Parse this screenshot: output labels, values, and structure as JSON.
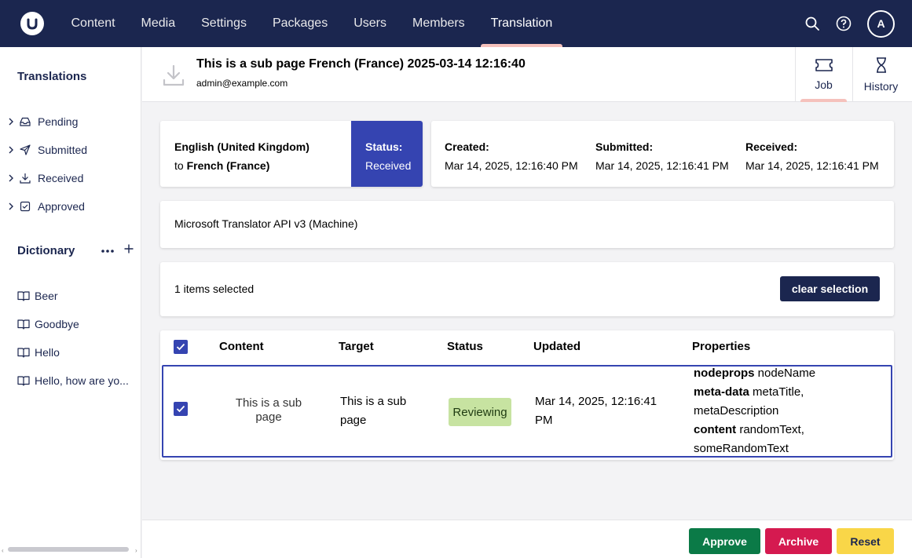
{
  "topbar": {
    "nav": [
      "Content",
      "Media",
      "Settings",
      "Packages",
      "Users",
      "Members",
      "Translation"
    ],
    "active": "Translation",
    "avatar_initial": "A",
    "colors": {
      "bar": "#1b264f",
      "active_underline": "#f5c1bc"
    }
  },
  "sidebar": {
    "translations_heading": "Translations",
    "items": [
      {
        "label": "Pending",
        "icon": "inbox-icon"
      },
      {
        "label": "Submitted",
        "icon": "send-icon"
      },
      {
        "label": "Received",
        "icon": "download-icon"
      },
      {
        "label": "Approved",
        "icon": "check-square-icon"
      }
    ],
    "dictionary_heading": "Dictionary",
    "dictionary_items": [
      "Beer",
      "Goodbye",
      "Hello",
      "Hello, how are yo..."
    ]
  },
  "header": {
    "title": "This is a sub page French (France) 2025-03-14 12:16:40",
    "subtitle": "admin@example.com",
    "tabs": [
      {
        "label": "Job",
        "icon": "ticket-icon",
        "active": true
      },
      {
        "label": "History",
        "icon": "hourglass-icon",
        "active": false
      }
    ]
  },
  "job": {
    "source_language": "English (United Kingdom)",
    "target_prefix": "to",
    "target_language": "French (France)",
    "status_label": "Status:",
    "status_value": "Received",
    "created_label": "Created:",
    "created_value": "Mar 14, 2025, 12:16:40 PM",
    "submitted_label": "Submitted:",
    "submitted_value": "Mar 14, 2025, 12:16:41 PM",
    "received_label": "Received:",
    "received_value": "Mar 14, 2025, 12:16:41 PM",
    "provider": "Microsoft Translator API v3 (Machine)"
  },
  "selection": {
    "text": "1 items selected",
    "clear_label": "clear selection"
  },
  "table": {
    "columns": [
      "Content",
      "Target",
      "Status",
      "Updated",
      "Properties"
    ],
    "rows": [
      {
        "content_line1": "This is a sub",
        "content_line2": "page",
        "target_line1": "This is a sub",
        "target_line2": "page",
        "status": "Reviewing",
        "updated_line1": "Mar 14, 2025, 12:16:41",
        "updated_line2": "PM",
        "properties": [
          {
            "group": "nodeprops",
            "values": "nodeName"
          },
          {
            "group": "meta-data",
            "values": "metaTitle,",
            "cont": "metaDescription"
          },
          {
            "group": "content",
            "values": "randomText,",
            "cont": "someRandomText"
          }
        ]
      }
    ]
  },
  "footer": {
    "approve_label": "Approve",
    "archive_label": "Archive",
    "reset_label": "Reset",
    "colors": {
      "approve": "#0b7a47",
      "archive": "#d51a50",
      "reset": "#f9d648"
    }
  }
}
